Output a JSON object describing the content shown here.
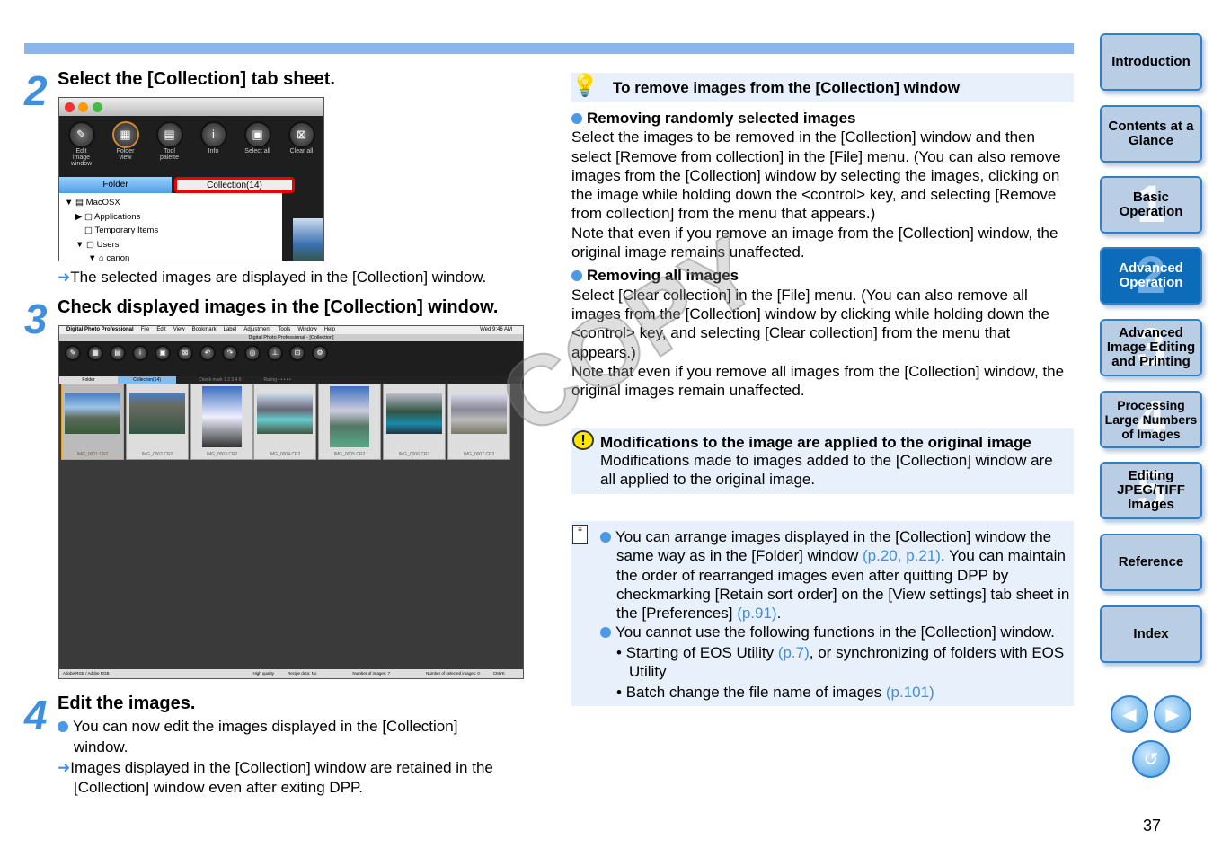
{
  "steps": [
    {
      "num": "2",
      "title": "Select the [Collection] tab sheet.",
      "note": "The selected images are displayed in the [Collection] window."
    },
    {
      "num": "3",
      "title": "Check displayed images in the [Collection] window."
    },
    {
      "num": "4",
      "title": "Edit the images.",
      "bullet": "You can now edit the images displayed in the [Collection] window.",
      "note": "Images displayed in the [Collection] window are retained in the [Collection] window even after exiting DPP."
    }
  ],
  "shot1": {
    "toolbar": [
      "Edit image window",
      "Folder view",
      "Tool palette",
      "Info",
      "Select all",
      "Clear all"
    ],
    "tab_folder": "Folder",
    "tab_collection": "Collection(14)",
    "tree": [
      "MacOSX",
      "Applications",
      "Temporary Items",
      "Users",
      "canon"
    ]
  },
  "shot2": {
    "menubar": [
      "Digital Photo Professional",
      "File",
      "Edit",
      "View",
      "Bookmark",
      "Label",
      "Adjustment",
      "Tools",
      "Window",
      "Help"
    ],
    "clock": "Wed 9:46 AM",
    "title": "Digital Photo Professional - [Collection]",
    "tab_folder": "Folder",
    "tab_collection": "Collection(14)",
    "check_mark": "Check mark  1 2 3 4 5",
    "rating": "Rating  • • • • •",
    "thumbs": [
      "IMG_0001.CR2",
      "IMG_0002.CR2",
      "IMG_0003.CR2",
      "IMG_0004.CR2",
      "IMG_0005.CR2",
      "IMG_0006.CR2",
      "IMG_0007.CR2"
    ],
    "status": [
      "Adobe RGB / Adobe RGB",
      "High quality",
      "Recipe data: No",
      "Number of images: 7",
      "Number of selected images: 0",
      "CMYK"
    ]
  },
  "tip": {
    "title": "To remove images from the [Collection] window",
    "s1_head": "Removing randomly selected images",
    "s1_p1": "Select the images to be removed in the [Collection] window and then select [Remove from collection] in the [File] menu. (You can also remove images from the [Collection] window by selecting the images, clicking on the image while holding down the <control> key, and selecting [Remove from collection] from the menu that appears.)",
    "s1_p2": "Note that even if you remove an image from the [Collection] window, the original image remains unaffected.",
    "s2_head": "Removing all images",
    "s2_p1": "Select [Clear collection] in the [File] menu. (You can also remove all images from the [Collection] window by clicking while holding down the <control> key, and selecting [Clear collection] from the menu that appears.)",
    "s2_p2": "Note that even if you remove all images from the [Collection] window, the original images remain unaffected."
  },
  "caution": {
    "title": "Modifications to the image are applied to the original image",
    "body": "Modifications made to images added to the [Collection] window are all applied to the original image."
  },
  "memo": {
    "b1a": "You can arrange images displayed in the [Collection] window the same way as in the [Folder] window ",
    "b1link1": "(p.20, p.21)",
    "b1b": ". You can maintain the order of rearranged images even after quitting DPP by checkmarking [Retain sort order] on the [View settings] tab sheet in the  [Preferences] ",
    "b1link2": "(p.91)",
    "b1c": ".",
    "b2": "You cannot use the following functions in the [Collection] window.",
    "sub1a": "Starting of EOS Utility ",
    "sub1link": "(p.7)",
    "sub1b": ", or synchronizing of folders with EOS Utility",
    "sub2a": "Batch change the file name of images ",
    "sub2link": "(p.101)"
  },
  "nav": [
    {
      "label": "Introduction"
    },
    {
      "label": "Contents at a Glance"
    },
    {
      "label": "Basic Operation",
      "num": "1"
    },
    {
      "label": "Advanced Operation",
      "num": "2",
      "active": true
    },
    {
      "label": "Advanced Image Editing and Printing",
      "num": "3"
    },
    {
      "label": "Processing Large Numbers of Images",
      "num": "4"
    },
    {
      "label": "Editing JPEG/TIFF Images",
      "num": "5"
    },
    {
      "label": "Reference"
    },
    {
      "label": "Index"
    }
  ],
  "watermark": "COPY",
  "page_number": "37",
  "colors": {
    "accent": "#3f8fdc",
    "nav_active": "#0c6cba",
    "nav_bg": "#b9cde5",
    "box_bg": "#e8f1fb"
  }
}
